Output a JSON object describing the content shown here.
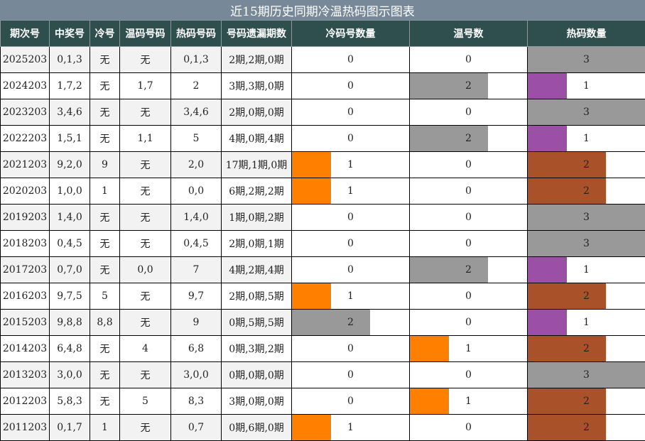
{
  "title": "近15期历史同期冷温热码图示图表",
  "headers": [
    "期次号",
    "中奖号",
    "冷号",
    "温码号码",
    "热码号码",
    "号码遗漏期数",
    "冷码号数量",
    "温号数",
    "热码数量"
  ],
  "colors": {
    "title_bg": "#778899",
    "header_bg": "#2f4f4f",
    "count_1": "#ff8000",
    "count_2": "#999999",
    "count_3": "#999999",
    "hot_1": "#9b4fa6",
    "hot_2": "#a9522a",
    "hot_3": "#999999"
  },
  "chart_data": {
    "type": "table",
    "max_count": 3,
    "rows": [
      {
        "period": "2025203",
        "numbers": "0,1,3",
        "cold": "无",
        "warm": "无",
        "hot": "0,1,3",
        "missing": "2期,2期,0期",
        "cold_count": 0,
        "warm_count": 0,
        "hot_count": 3
      },
      {
        "period": "2024203",
        "numbers": "1,7,2",
        "cold": "无",
        "warm": "1,7",
        "hot": "2",
        "missing": "3期,3期,0期",
        "cold_count": 0,
        "warm_count": 2,
        "hot_count": 1
      },
      {
        "period": "2023203",
        "numbers": "3,4,6",
        "cold": "无",
        "warm": "无",
        "hot": "3,4,6",
        "missing": "2期,0期,0期",
        "cold_count": 0,
        "warm_count": 0,
        "hot_count": 3
      },
      {
        "period": "2022203",
        "numbers": "1,5,1",
        "cold": "无",
        "warm": "1,1",
        "hot": "5",
        "missing": "4期,0期,4期",
        "cold_count": 0,
        "warm_count": 2,
        "hot_count": 1
      },
      {
        "period": "2021203",
        "numbers": "9,2,0",
        "cold": "9",
        "warm": "无",
        "hot": "2,0",
        "missing": "17期,1期,0期",
        "cold_count": 1,
        "warm_count": 0,
        "hot_count": 2
      },
      {
        "period": "2020203",
        "numbers": "1,0,0",
        "cold": "1",
        "warm": "无",
        "hot": "0,0",
        "missing": "6期,2期,2期",
        "cold_count": 1,
        "warm_count": 0,
        "hot_count": 2
      },
      {
        "period": "2019203",
        "numbers": "1,4,0",
        "cold": "无",
        "warm": "无",
        "hot": "1,4,0",
        "missing": "1期,0期,2期",
        "cold_count": 0,
        "warm_count": 0,
        "hot_count": 3
      },
      {
        "period": "2018203",
        "numbers": "0,4,5",
        "cold": "无",
        "warm": "无",
        "hot": "0,4,5",
        "missing": "2期,0期,1期",
        "cold_count": 0,
        "warm_count": 0,
        "hot_count": 3
      },
      {
        "period": "2017203",
        "numbers": "0,7,0",
        "cold": "无",
        "warm": "0,0",
        "hot": "7",
        "missing": "4期,2期,4期",
        "cold_count": 0,
        "warm_count": 2,
        "hot_count": 1
      },
      {
        "period": "2016203",
        "numbers": "9,7,5",
        "cold": "5",
        "warm": "无",
        "hot": "9,7",
        "missing": "2期,0期,5期",
        "cold_count": 1,
        "warm_count": 0,
        "hot_count": 2
      },
      {
        "period": "2015203",
        "numbers": "9,8,8",
        "cold": "8,8",
        "warm": "无",
        "hot": "9",
        "missing": "0期,5期,5期",
        "cold_count": 2,
        "warm_count": 0,
        "hot_count": 1
      },
      {
        "period": "2014203",
        "numbers": "6,4,8",
        "cold": "无",
        "warm": "4",
        "hot": "6,8",
        "missing": "0期,3期,2期",
        "cold_count": 0,
        "warm_count": 1,
        "hot_count": 2
      },
      {
        "period": "2013203",
        "numbers": "3,0,0",
        "cold": "无",
        "warm": "无",
        "hot": "3,0,0",
        "missing": "0期,0期,0期",
        "cold_count": 0,
        "warm_count": 0,
        "hot_count": 3
      },
      {
        "period": "2012203",
        "numbers": "5,8,3",
        "cold": "无",
        "warm": "5",
        "hot": "8,3",
        "missing": "3期,0期,0期",
        "cold_count": 0,
        "warm_count": 1,
        "hot_count": 2
      },
      {
        "period": "2011203",
        "numbers": "0,1,7",
        "cold": "1",
        "warm": "无",
        "hot": "0,7",
        "missing": "0期,6期,0期",
        "cold_count": 1,
        "warm_count": 0,
        "hot_count": 2
      }
    ]
  }
}
